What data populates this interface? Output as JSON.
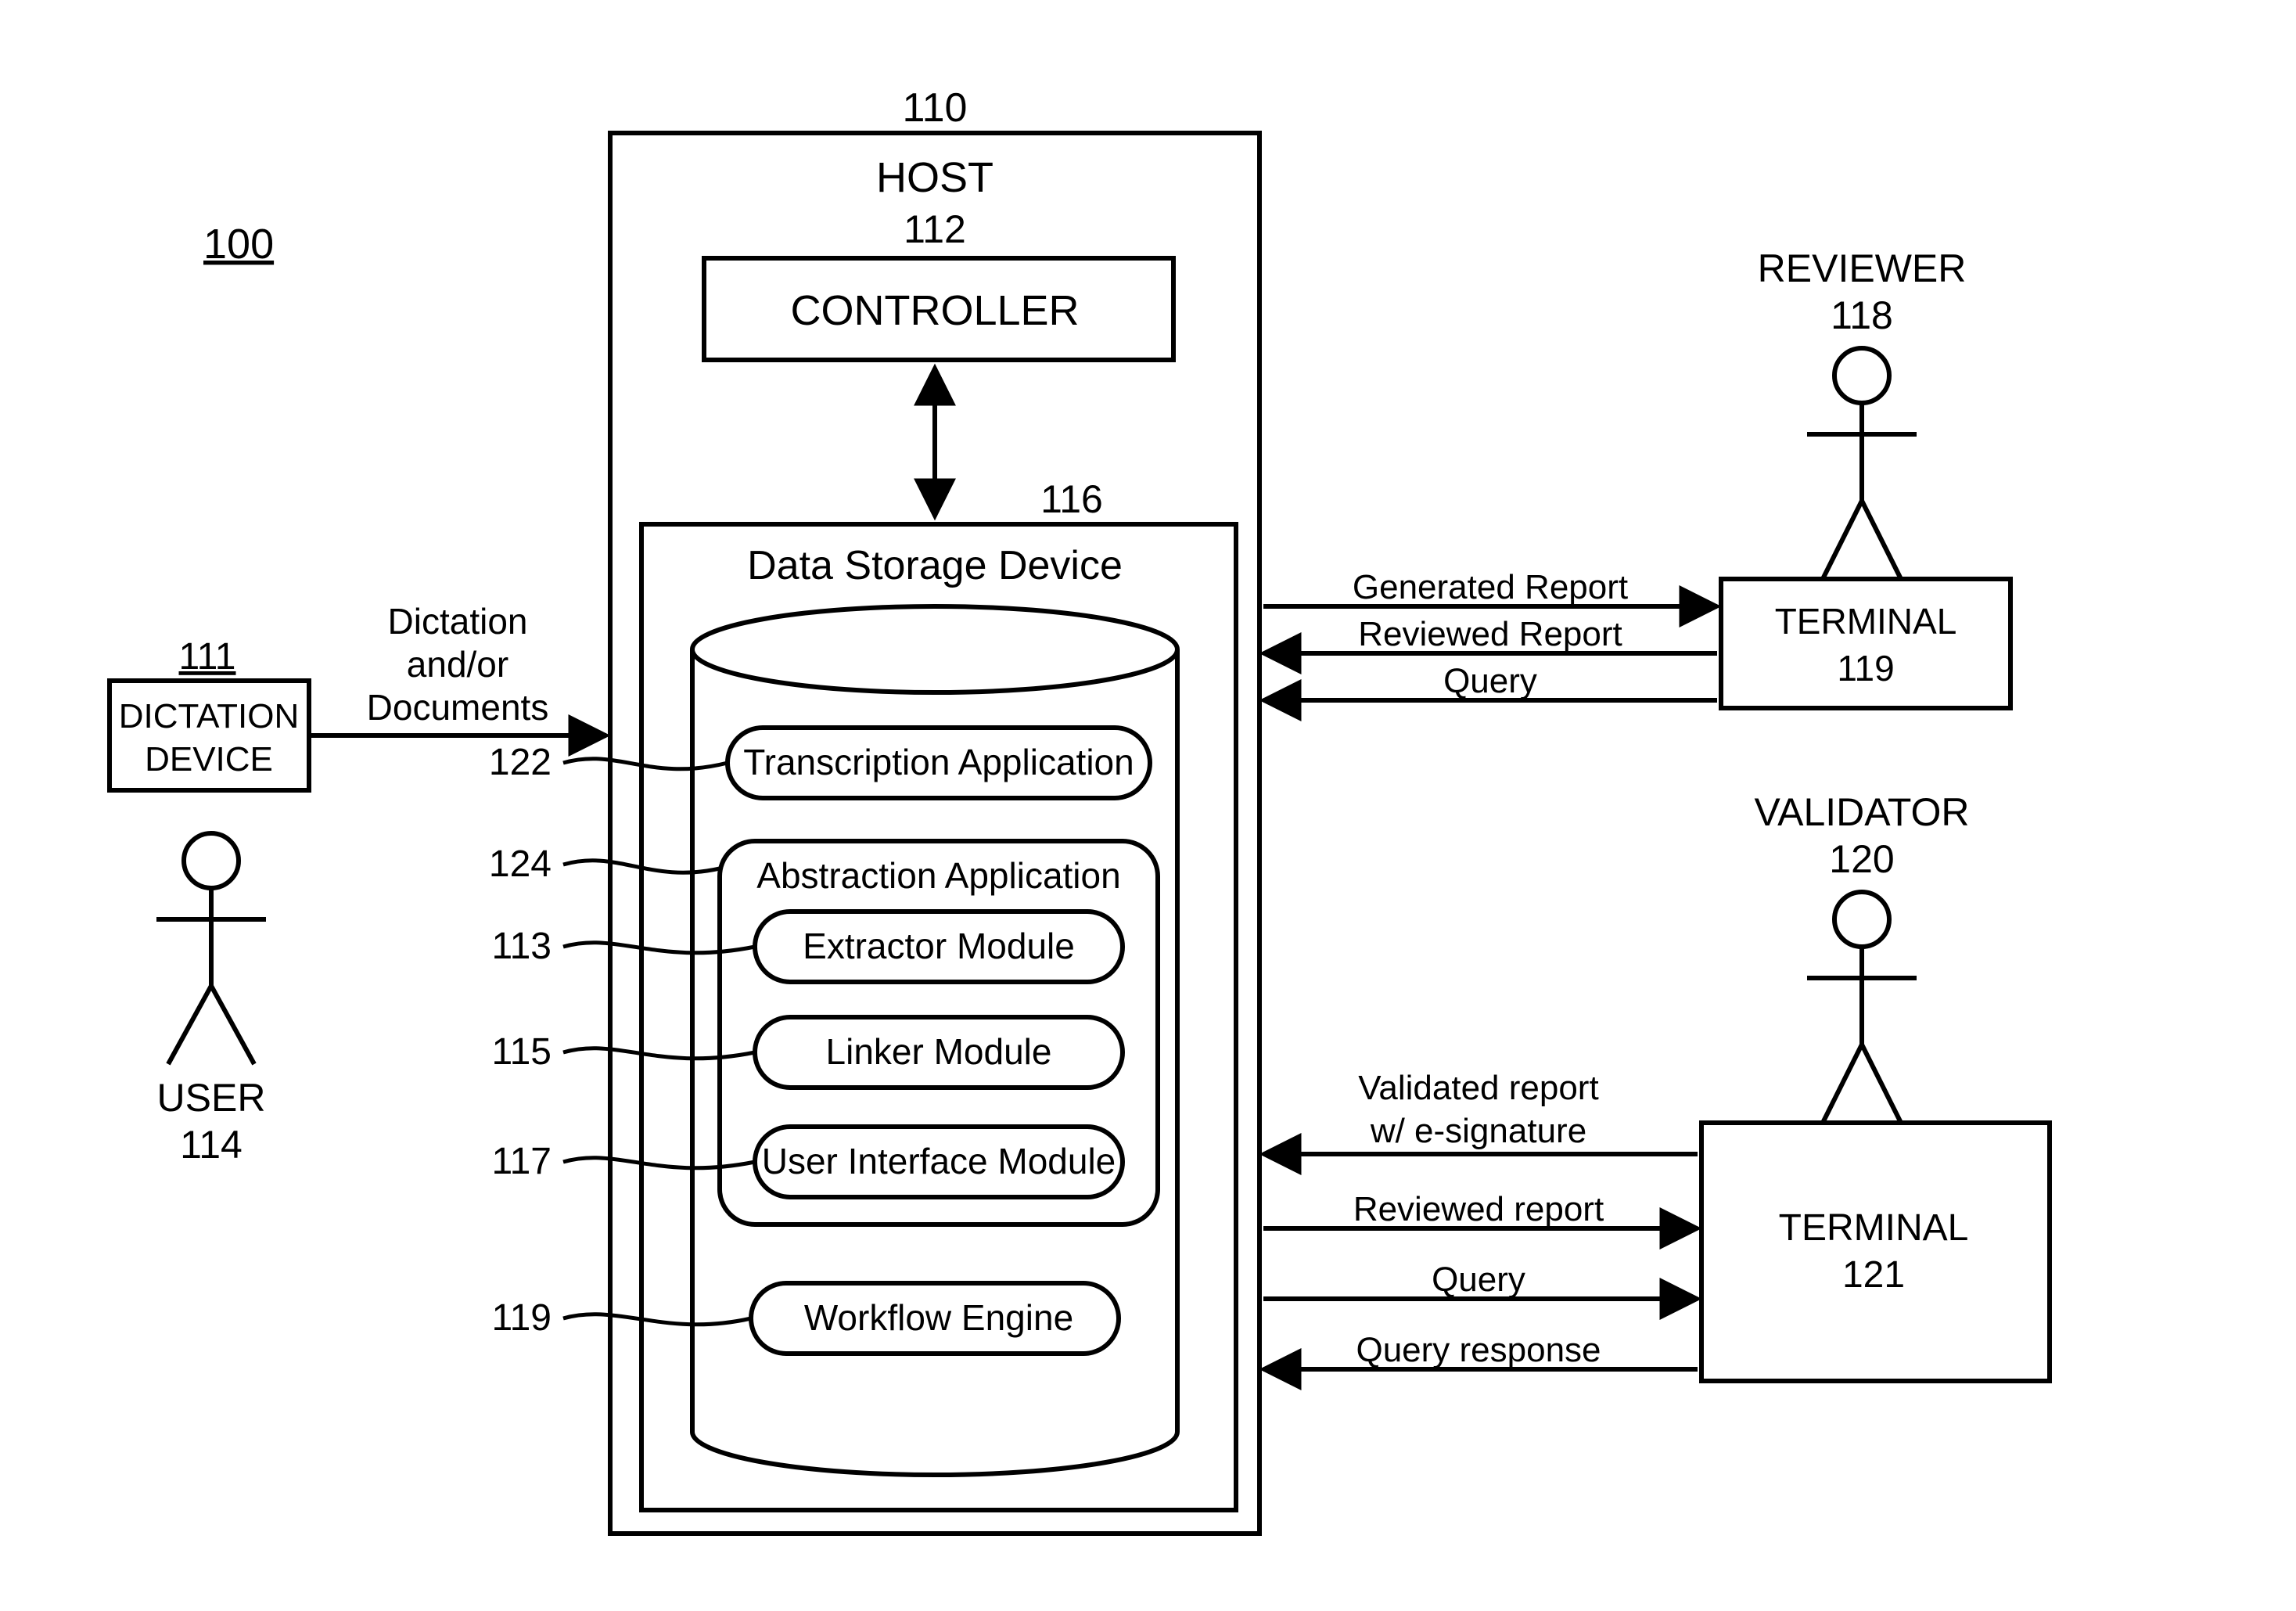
{
  "figure_ref": "100",
  "host": {
    "ref": "110",
    "label": "HOST"
  },
  "controller": {
    "ref": "112",
    "label": "CONTROLLER"
  },
  "dsd": {
    "ref": "116",
    "label": "Data Storage Device"
  },
  "modules": {
    "transcription": "Transcription Application",
    "abstraction": "Abstraction Application",
    "extractor": "Extractor Module",
    "linker": "Linker Module",
    "ui": "User Interface Module",
    "workflow": "Workflow Engine"
  },
  "leads": {
    "transcription": "122",
    "abstraction": "124",
    "extractor": "113",
    "linker": "115",
    "ui": "117",
    "workflow": "119"
  },
  "dictation_device": {
    "ref": "111",
    "label_line1": "DICTATION",
    "label_line2": "DEVICE"
  },
  "user": {
    "label": "USER",
    "ref": "114"
  },
  "reviewer": {
    "label": "REVIEWER",
    "ref": "118"
  },
  "validator": {
    "label": "VALIDATOR",
    "ref": "120"
  },
  "terminal_top": {
    "label": "TERMINAL",
    "ref": "119"
  },
  "terminal_bottom": {
    "label": "TERMINAL",
    "ref": "121"
  },
  "arrows": {
    "dictation_line1": "Dictation",
    "dictation_line2": "and/or",
    "dictation_line3": "Documents",
    "gen_report": "Generated Report",
    "rev_report_top": "Reviewed Report",
    "query_top": "Query",
    "validated_line1": "Validated report",
    "validated_line2": "w/ e-signature",
    "rev_report_bot": "Reviewed report",
    "query_bot": "Query",
    "query_resp": "Query response"
  }
}
